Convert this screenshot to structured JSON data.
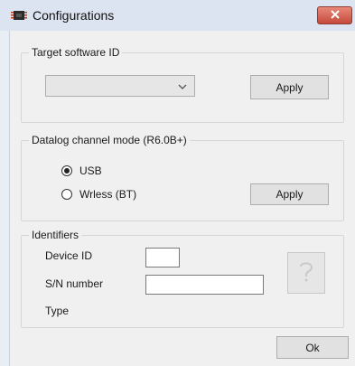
{
  "window": {
    "title": "Configurations",
    "close_icon": "close-icon",
    "app_icon": "device-chip-icon"
  },
  "target_group": {
    "legend": "Target software ID",
    "select_value": "",
    "apply_label": "Apply"
  },
  "datalog_group": {
    "legend": "Datalog channel mode (R6.0B+)",
    "options": [
      {
        "label": "USB",
        "checked": true
      },
      {
        "label": "Wrless (BT)",
        "checked": false
      }
    ],
    "apply_label": "Apply"
  },
  "identifiers_group": {
    "legend": "Identifiers",
    "device_id_label": "Device ID",
    "device_id_value": "",
    "sn_label": "S/N number",
    "sn_value": "",
    "type_label": "Type",
    "help_icon": "question-mark-icon"
  },
  "footer": {
    "ok_label": "Ok"
  },
  "colors": {
    "titlebar": "#dde4f1",
    "close_button": "#c44a3b",
    "dialog_background": "#f0f0f0"
  }
}
